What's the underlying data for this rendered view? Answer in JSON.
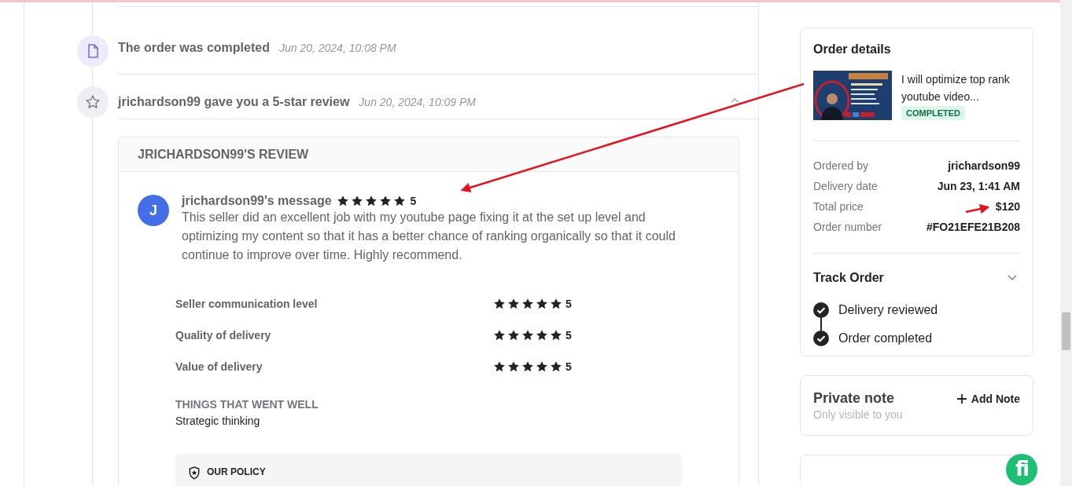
{
  "timeline": [
    {
      "kind": "document",
      "title": "The order was completed",
      "date": "Jun 20, 2024, 10:08 PM",
      "expanded": false
    },
    {
      "kind": "star",
      "title": "jrichardson99 gave you a 5-star review",
      "date": "Jun 20, 2024, 10:09 PM",
      "expanded": true
    }
  ],
  "review": {
    "heading": "JRICHARDSON99'S REVIEW",
    "avatar": "J",
    "author": "jrichardson99's message",
    "stars": 5,
    "score": "5",
    "message": "This seller did an excellent job with my youtube page fixing it at the set up level and optimizing my content so that it has a better chance of ranking organically so that it could continue to improve over time. Highly recommend.",
    "ratings": [
      {
        "label": "Seller communication level",
        "stars": 5,
        "score": "5"
      },
      {
        "label": "Quality of delivery",
        "stars": 5,
        "score": "5"
      },
      {
        "label": "Value of delivery",
        "stars": 5,
        "score": "5"
      }
    ],
    "went_well_heading": "THINGS THAT WENT WELL",
    "went_well": "Strategic thinking",
    "policy": "OUR POLICY"
  },
  "order_details": {
    "title": "Order details",
    "gig_title": "I will optimize top rank youtube video...",
    "status": "COMPLETED",
    "rows": [
      {
        "label": "Ordered by",
        "value": "jrichardson99"
      },
      {
        "label": "Delivery date",
        "value": "Jun 23, 1:41 AM"
      },
      {
        "label": "Total price",
        "value": "$120"
      },
      {
        "label": "Order number",
        "value": "#FO21EFE21B208"
      }
    ],
    "track_title": "Track Order",
    "track_expanded": true,
    "steps": [
      {
        "label": "Delivery reviewed",
        "done": true
      },
      {
        "label": "Order completed",
        "done": true
      }
    ]
  },
  "private_note": {
    "title": "Private note",
    "subtitle": "Only visible to you",
    "action": "Add Note"
  },
  "chat_button": {
    "label": "fi"
  }
}
